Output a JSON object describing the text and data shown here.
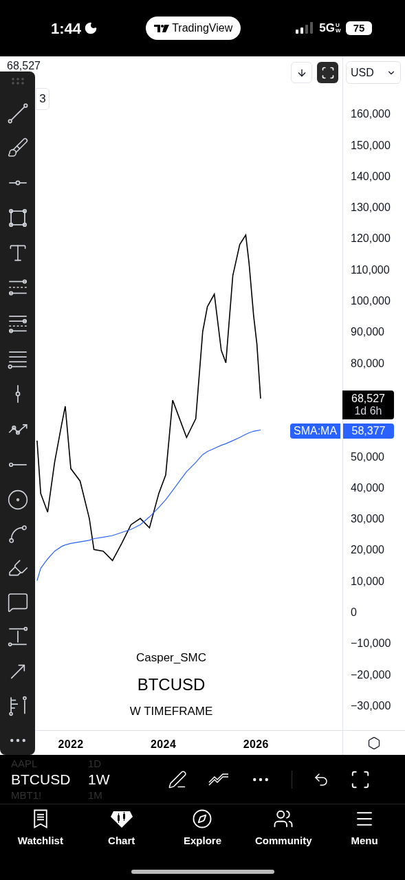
{
  "status_bar": {
    "time": "1:44",
    "app_pill": "TradingView",
    "network": "5G",
    "network_suffix": "UW",
    "battery": "75"
  },
  "legend": {
    "value": "68,527",
    "badge": "3"
  },
  "currency": {
    "value": "USD"
  },
  "chart": {
    "watermark": [
      "Casper_SMC",
      "W TIMEFRAME"
    ],
    "price_label": {
      "value": "68,527",
      "countdown": "1d 6h"
    },
    "indicator_label": {
      "value": "58,377"
    },
    "chart_data": {
      "type": "line",
      "xlim": [
        2020.47,
        2029.22
      ],
      "ylim": [
        -37970,
        178370
      ],
      "x": [
        2021.27,
        2021.35,
        2021.5,
        2021.65,
        2021.8,
        2021.88,
        2022.0,
        2022.2,
        2022.4,
        2022.5,
        2022.7,
        2022.9,
        2023.1,
        2023.3,
        2023.5,
        2023.7,
        2023.9,
        2024.05,
        2024.2,
        2024.35,
        2024.5,
        2024.7,
        2024.85,
        2024.95,
        2025.1,
        2025.25,
        2025.35,
        2025.5,
        2025.65,
        2025.78,
        2025.85,
        2025.95,
        2026.02,
        2026.1
      ],
      "series": [
        {
          "name": "BTCUSD",
          "color": "#000000",
          "values": [
            55000,
            38000,
            32000,
            48000,
            60000,
            66000,
            46000,
            42000,
            30000,
            20000,
            19500,
            16500,
            22000,
            28000,
            30000,
            27000,
            38000,
            44000,
            68000,
            62000,
            56000,
            62000,
            90000,
            98000,
            102000,
            84000,
            80000,
            108000,
            118000,
            121000,
            112000,
            95000,
            86000,
            68500
          ]
        },
        {
          "name": "SMA:MA",
          "color": "#2962ff",
          "values": [
            10000,
            14000,
            17000,
            19500,
            21000,
            21500,
            22000,
            22500,
            23000,
            23500,
            24000,
            24500,
            25500,
            26500,
            28000,
            30500,
            33500,
            36000,
            39000,
            42000,
            45000,
            48000,
            50500,
            51500,
            52500,
            53500,
            54000,
            55000,
            56000,
            57000,
            57500,
            58000,
            58200,
            58400
          ]
        }
      ],
      "xticks": [
        {
          "value": 2022,
          "label": "2022"
        },
        {
          "value": 2024,
          "label": "2024"
        },
        {
          "value": 2026,
          "label": "2026"
        }
      ],
      "yticks": [
        {
          "value": 160000,
          "label": "160,000"
        },
        {
          "value": 150000,
          "label": "150,000"
        },
        {
          "value": 140000,
          "label": "140,000"
        },
        {
          "value": 130000,
          "label": "130,000"
        },
        {
          "value": 120000,
          "label": "120,000"
        },
        {
          "value": 110000,
          "label": "110,000"
        },
        {
          "value": 100000,
          "label": "100,000"
        },
        {
          "value": 90000,
          "label": "90,000"
        },
        {
          "value": 80000,
          "label": "80,000"
        },
        {
          "value": 50000,
          "label": "50,000"
        },
        {
          "value": 40000,
          "label": "40,000"
        },
        {
          "value": 30000,
          "label": "30,000"
        },
        {
          "value": 20000,
          "label": "20,000"
        },
        {
          "value": 10000,
          "label": "10,000"
        },
        {
          "value": 0,
          "label": "0"
        },
        {
          "value": -10000,
          "label": "−10,000"
        },
        {
          "value": -20000,
          "label": "−20,000"
        },
        {
          "value": -30000,
          "label": "−30,000"
        }
      ]
    }
  },
  "symbol_bar": {
    "symbols": [
      {
        "symbol": "AAPL",
        "interval": "1D",
        "selected": false
      },
      {
        "symbol": "BTCUSD",
        "interval": "1W",
        "selected": true
      },
      {
        "symbol": "MBT1!",
        "interval": "1M",
        "selected": false
      }
    ]
  },
  "nav": [
    {
      "label": "Watchlist"
    },
    {
      "label": "Chart"
    },
    {
      "label": "Explore"
    },
    {
      "label": "Community"
    },
    {
      "label": "Menu"
    }
  ]
}
